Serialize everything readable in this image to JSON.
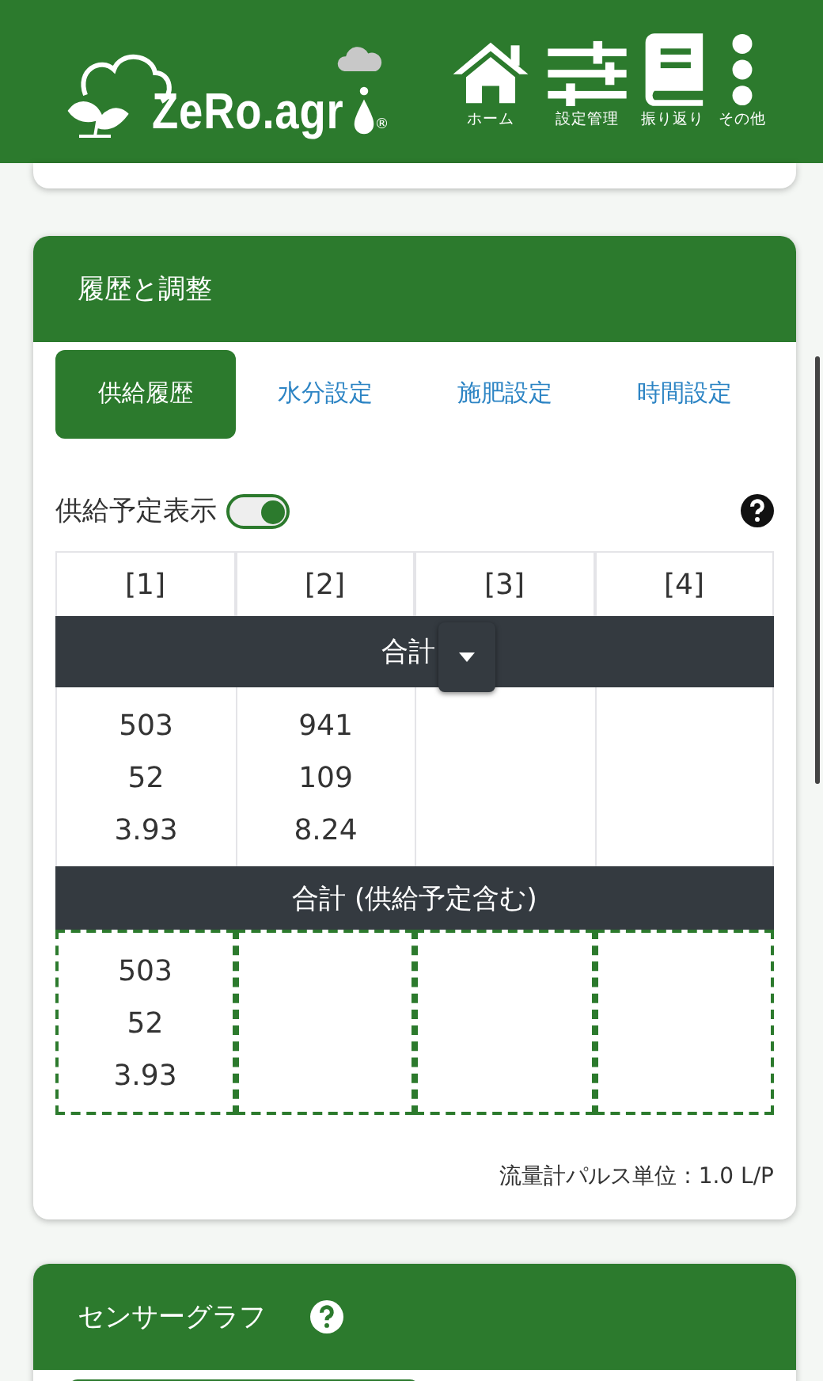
{
  "header": {
    "logo_text": "ZeRo.agr",
    "logo_mark": "®",
    "nav": [
      {
        "label": "ホーム"
      },
      {
        "label": "設定管理"
      },
      {
        "label": "振り返り"
      },
      {
        "label": "その他"
      }
    ]
  },
  "history_card": {
    "title": "履歴と調整",
    "tabs": [
      {
        "label": "供給履歴",
        "selected": true
      },
      {
        "label": "水分設定",
        "selected": false
      },
      {
        "label": "施肥設定",
        "selected": false
      },
      {
        "label": "時間設定",
        "selected": false
      }
    ],
    "toggle": {
      "label": "供給予定表示",
      "on": true
    },
    "table": {
      "columns": [
        "[1]",
        "[2]",
        "[3]",
        "[4]"
      ],
      "sections": [
        {
          "title": "合計",
          "dropdown": true,
          "kind": "actual",
          "cells": [
            {
              "lines": [
                "503",
                "52",
                "3.93"
              ]
            },
            {
              "lines": [
                "941",
                "109",
                "8.24"
              ]
            },
            {},
            {}
          ]
        },
        {
          "title": "合計 (供給予定含む)",
          "dropdown": false,
          "kind": "planned",
          "cells": [
            {
              "lines": [
                "503",
                "52",
                "3.93"
              ]
            },
            {},
            {},
            {}
          ]
        }
      ]
    },
    "footer": "流量計パルス単位 : 1.0 L/P"
  },
  "sensor_card": {
    "title": "センサーグラフ"
  }
}
